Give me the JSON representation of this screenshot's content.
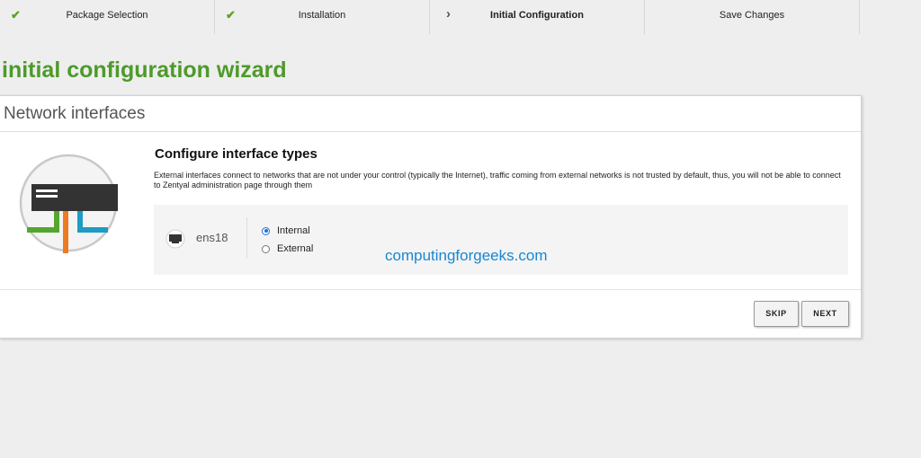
{
  "steps": [
    {
      "label": "Package Selection",
      "state": "done",
      "icon": "check-icon"
    },
    {
      "label": "Installation",
      "state": "done",
      "icon": "check-icon"
    },
    {
      "label": "Initial Configuration",
      "state": "current",
      "icon": "chevron-right-icon"
    },
    {
      "label": "Save Changes",
      "state": "pending",
      "icon": ""
    }
  ],
  "wizard_title": "initial configuration wizard",
  "panel": {
    "title": "Network interfaces",
    "section_title": "Configure interface types",
    "description": "External interfaces connect to networks that are not under your control (typically the Internet), traffic coming from external networks is not trusted by default, thus, you will not be able to connect to Zentyal administration page through them",
    "illustration_icon": "network-switch-icon"
  },
  "interface": {
    "name": "ens18",
    "icon": "network-port-icon",
    "options": [
      {
        "label": "Internal",
        "selected": true
      },
      {
        "label": "External",
        "selected": false
      }
    ]
  },
  "watermark": "computingforgeeks.com",
  "buttons": {
    "skip": "SKIP",
    "next": "NEXT"
  },
  "colors": {
    "accent_green": "#4e9a2a",
    "check_green": "#5aa323",
    "radio_blue": "#1f6fd6",
    "watermark_blue": "#1a86d0"
  }
}
